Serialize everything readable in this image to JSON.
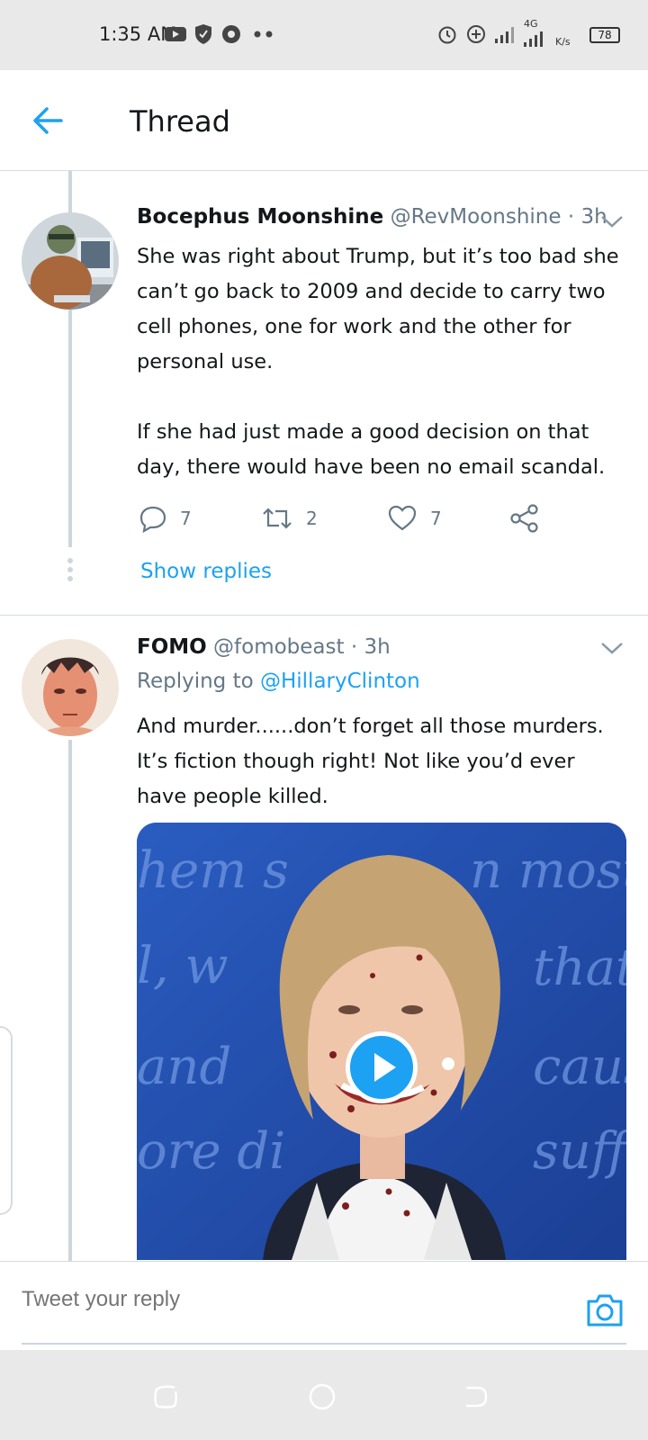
{
  "status_bar": {
    "time": "1:35 AM",
    "network": "4G",
    "speed": "K/s",
    "battery": "78"
  },
  "header": {
    "title": "Thread"
  },
  "tweets": [
    {
      "name": "Bocephus Moonshine",
      "handle": "@RevMoonshine",
      "time": "· 3h",
      "text": "She was right about Trump, but it’s too bad she can’t go back to 2009 and decide to carry two cell phones, one for work and the other for personal use.\n\nIf she had just made a good decision on that day, there would have been no email scandal.",
      "replies": "7",
      "retweets": "2",
      "likes": "7",
      "show_replies": "Show replies"
    },
    {
      "name": "FOMO",
      "handle": "@fomobeast",
      "time": "· 3h",
      "replying_prefix": "Replying to",
      "replying_to": "@HillaryClinton",
      "text": "And murder......don’t forget all those murders. It’s fiction though right! Not like you’d ever have people killed.",
      "media_words": [
        "hem s",
        "n most",
        "l, w",
        "that",
        "and",
        "caus",
        "ore di",
        "suffe"
      ]
    }
  ],
  "reply_bar": {
    "placeholder": "Tweet your reply"
  },
  "colors": {
    "accent": "#1da1f2",
    "secondary_text": "#657786",
    "divider": "#d6dbe0",
    "status_bg": "#e9e9e9"
  }
}
